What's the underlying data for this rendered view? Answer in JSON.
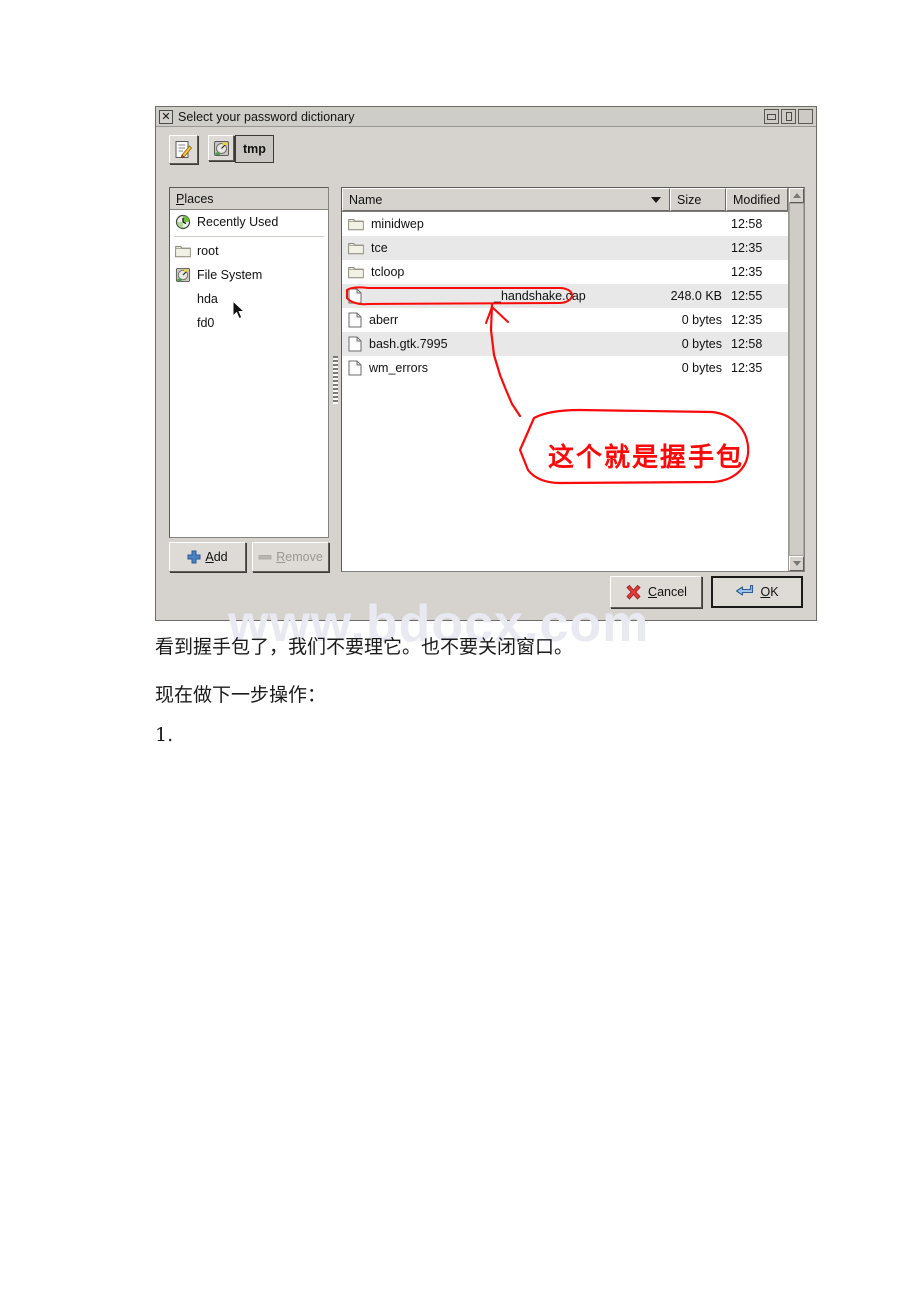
{
  "window": {
    "title": "Select your password dictionary",
    "close_glyph": "✕",
    "buttons": {
      "minimize": "minimize-box",
      "maximize": "maximize-box",
      "restore": "restore-box"
    }
  },
  "toolbar": {
    "type_filename_icon": "pencil-document-icon",
    "path_root_icon": "harddisk-icon",
    "breadcrumb_current": "tmp"
  },
  "places": {
    "header": "Places",
    "header_mnemonic": "P",
    "items": [
      {
        "label": "Recently Used",
        "icon": "recent-clock-icon",
        "indent": false
      },
      {
        "label": "root",
        "icon": "folder-icon",
        "indent": false
      },
      {
        "label": "File System",
        "icon": "harddisk-icon",
        "indent": false
      },
      {
        "label": "hda",
        "icon": "none",
        "indent": true
      },
      {
        "label": "fd0",
        "icon": "none",
        "indent": true
      }
    ],
    "add_label": "Add",
    "add_mnemonic": "A",
    "add_icon": "plus-icon",
    "remove_label": "Remove",
    "remove_mnemonic": "R",
    "remove_icon": "minus-icon",
    "remove_disabled": true
  },
  "file_list": {
    "columns": [
      {
        "key": "name",
        "label": "Name",
        "sorted": true,
        "sort_dir": "descending"
      },
      {
        "key": "size",
        "label": "Size"
      },
      {
        "key": "modified",
        "label": "Modified"
      }
    ],
    "rows": [
      {
        "name": "minidwep",
        "icon": "folder-icon",
        "size": "",
        "modified": "12:58"
      },
      {
        "name": "tce",
        "icon": "folder-icon",
        "size": "",
        "modified": "12:35"
      },
      {
        "name": "tcloop",
        "icon": "folder-icon",
        "size": "",
        "modified": "12:35"
      },
      {
        "name": "_handshake.cap",
        "icon": "file-icon",
        "size": "248.0 KB",
        "modified": "12:55",
        "redacted_prefix": true
      },
      {
        "name": "aberr",
        "icon": "file-icon",
        "size": "0 bytes",
        "modified": "12:35"
      },
      {
        "name": "bash.gtk.7995",
        "icon": "file-icon",
        "size": "0 bytes",
        "modified": "12:58"
      },
      {
        "name": "wm_errors",
        "icon": "file-icon",
        "size": "0 bytes",
        "modified": "12:35"
      }
    ]
  },
  "actions": {
    "cancel_label": "Cancel",
    "cancel_mnemonic": "C",
    "cancel_icon": "red-x-icon",
    "ok_label": "OK",
    "ok_mnemonic": "O",
    "ok_icon": "blue-enter-arrow-icon",
    "ok_focused": true
  },
  "annotation": {
    "text": "这个就是握手包",
    "color": "#fb0a0a",
    "shape": "callout-balloon-with-arrow"
  },
  "watermark": {
    "text": "www.bdocx.com",
    "color": "#e9e9f2"
  },
  "page_text": {
    "line1": "看到握手包了，我们不要理它。也不要关闭窗口。",
    "line2": "现在做下一步操作：",
    "line3": "1."
  },
  "cursor": {
    "icon": "mouse-pointer-icon"
  }
}
